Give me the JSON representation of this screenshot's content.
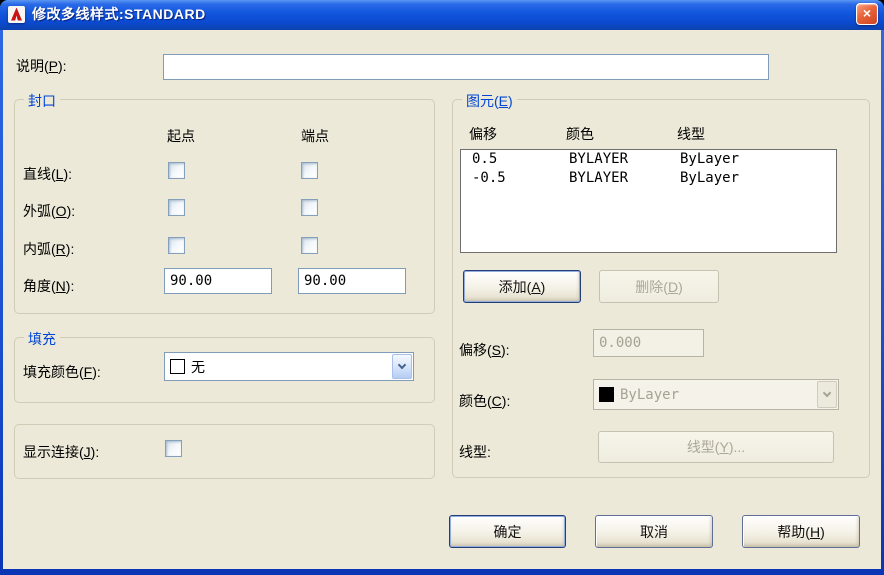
{
  "window": {
    "title": "修改多线样式:STANDARD",
    "close_glyph": "×",
    "icons": {
      "app": "autocad-logo",
      "close": "close-x",
      "combo": "chevron-down"
    }
  },
  "description": {
    "label": {
      "pre": "说明(",
      "key": "P",
      "post": "):"
    },
    "value": ""
  },
  "caps": {
    "title": "封口",
    "col_start": "起点",
    "col_end": "端点",
    "rows": [
      {
        "label": {
          "pre": "直线(",
          "key": "L",
          "post": "):"
        },
        "start_checked": false,
        "end_checked": false
      },
      {
        "label": {
          "pre": "外弧(",
          "key": "O",
          "post": "):"
        },
        "start_checked": false,
        "end_checked": false
      },
      {
        "label": {
          "pre": "内弧(",
          "key": "R",
          "post": "):"
        },
        "start_checked": false,
        "end_checked": false
      }
    ],
    "angle": {
      "label": {
        "pre": "角度(",
        "key": "N",
        "post": "):"
      },
      "start_value": "90.00",
      "end_value": "90.00"
    }
  },
  "fill": {
    "title": "填充",
    "color_label": {
      "pre": "填充颜色(",
      "key": "F",
      "post": "):"
    },
    "value": "无",
    "swatch": "#ffffff"
  },
  "joints": {
    "label": {
      "pre": "显示连接(",
      "key": "J",
      "post": "):"
    },
    "checked": false
  },
  "elements": {
    "title": {
      "pre": "图元(",
      "key": "E",
      "post": ")"
    },
    "columns": [
      "偏移",
      "颜色",
      "线型"
    ],
    "rows": [
      {
        "offset": "0.5",
        "color": "BYLAYER",
        "linetype": "ByLayer"
      },
      {
        "offset": "-0.5",
        "color": "BYLAYER",
        "linetype": "ByLayer"
      }
    ],
    "add_button": {
      "pre": "添加(",
      "key": "A",
      "post": ")"
    },
    "delete_button": {
      "pre": "删除(",
      "key": "D",
      "post": ")"
    },
    "offset": {
      "label": {
        "pre": "偏移(",
        "key": "S",
        "post": "):"
      },
      "value": "0.000",
      "disabled": true
    },
    "color": {
      "label": {
        "pre": "颜色(",
        "key": "C",
        "post": "):"
      },
      "value": "ByLayer",
      "swatch": "#000000",
      "disabled": true
    },
    "linetype": {
      "label": "线型:",
      "button": {
        "pre": "线型(",
        "key": "Y",
        "post": ")..."
      },
      "disabled": true
    }
  },
  "footer": {
    "ok": "确定",
    "cancel": "取消",
    "help": {
      "pre": "帮助(",
      "key": "H",
      "post": ")"
    }
  },
  "colors": {
    "titlebar_blue": "#1257dd",
    "frame_blue": "#1b50cf",
    "dialog_bg": "#ece9d8",
    "group_title_blue": "#0046d5",
    "input_border": "#7f9db9",
    "disabled_text": "#aca899",
    "close_red": "#e0562c",
    "list_border": "#6f6f6f"
  }
}
